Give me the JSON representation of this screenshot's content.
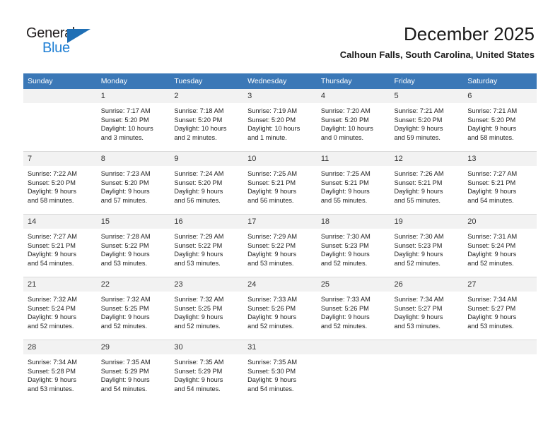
{
  "brand": {
    "name_top": "General",
    "name_bottom": "Blue",
    "triangle_color": "#1f6fb5",
    "blue_color": "#1f7fd4"
  },
  "header": {
    "title": "December 2025",
    "subtitle": "Calhoun Falls, South Carolina, United States"
  },
  "theme": {
    "header_row_bg": "#3b78b7",
    "header_row_text": "#ffffff",
    "daynum_bg": "#f2f2f2",
    "cell_border": "#d9d9d9"
  },
  "weekday_headers": [
    "Sunday",
    "Monday",
    "Tuesday",
    "Wednesday",
    "Thursday",
    "Friday",
    "Saturday"
  ],
  "weeks": [
    [
      {
        "day": "",
        "sunrise": "",
        "sunset": "",
        "daylight_line1": "",
        "daylight_line2": ""
      },
      {
        "day": "1",
        "sunrise": "Sunrise: 7:17 AM",
        "sunset": "Sunset: 5:20 PM",
        "daylight_line1": "Daylight: 10 hours",
        "daylight_line2": "and 3 minutes."
      },
      {
        "day": "2",
        "sunrise": "Sunrise: 7:18 AM",
        "sunset": "Sunset: 5:20 PM",
        "daylight_line1": "Daylight: 10 hours",
        "daylight_line2": "and 2 minutes."
      },
      {
        "day": "3",
        "sunrise": "Sunrise: 7:19 AM",
        "sunset": "Sunset: 5:20 PM",
        "daylight_line1": "Daylight: 10 hours",
        "daylight_line2": "and 1 minute."
      },
      {
        "day": "4",
        "sunrise": "Sunrise: 7:20 AM",
        "sunset": "Sunset: 5:20 PM",
        "daylight_line1": "Daylight: 10 hours",
        "daylight_line2": "and 0 minutes."
      },
      {
        "day": "5",
        "sunrise": "Sunrise: 7:21 AM",
        "sunset": "Sunset: 5:20 PM",
        "daylight_line1": "Daylight: 9 hours",
        "daylight_line2": "and 59 minutes."
      },
      {
        "day": "6",
        "sunrise": "Sunrise: 7:21 AM",
        "sunset": "Sunset: 5:20 PM",
        "daylight_line1": "Daylight: 9 hours",
        "daylight_line2": "and 58 minutes."
      }
    ],
    [
      {
        "day": "7",
        "sunrise": "Sunrise: 7:22 AM",
        "sunset": "Sunset: 5:20 PM",
        "daylight_line1": "Daylight: 9 hours",
        "daylight_line2": "and 58 minutes."
      },
      {
        "day": "8",
        "sunrise": "Sunrise: 7:23 AM",
        "sunset": "Sunset: 5:20 PM",
        "daylight_line1": "Daylight: 9 hours",
        "daylight_line2": "and 57 minutes."
      },
      {
        "day": "9",
        "sunrise": "Sunrise: 7:24 AM",
        "sunset": "Sunset: 5:20 PM",
        "daylight_line1": "Daylight: 9 hours",
        "daylight_line2": "and 56 minutes."
      },
      {
        "day": "10",
        "sunrise": "Sunrise: 7:25 AM",
        "sunset": "Sunset: 5:21 PM",
        "daylight_line1": "Daylight: 9 hours",
        "daylight_line2": "and 56 minutes."
      },
      {
        "day": "11",
        "sunrise": "Sunrise: 7:25 AM",
        "sunset": "Sunset: 5:21 PM",
        "daylight_line1": "Daylight: 9 hours",
        "daylight_line2": "and 55 minutes."
      },
      {
        "day": "12",
        "sunrise": "Sunrise: 7:26 AM",
        "sunset": "Sunset: 5:21 PM",
        "daylight_line1": "Daylight: 9 hours",
        "daylight_line2": "and 55 minutes."
      },
      {
        "day": "13",
        "sunrise": "Sunrise: 7:27 AM",
        "sunset": "Sunset: 5:21 PM",
        "daylight_line1": "Daylight: 9 hours",
        "daylight_line2": "and 54 minutes."
      }
    ],
    [
      {
        "day": "14",
        "sunrise": "Sunrise: 7:27 AM",
        "sunset": "Sunset: 5:21 PM",
        "daylight_line1": "Daylight: 9 hours",
        "daylight_line2": "and 54 minutes."
      },
      {
        "day": "15",
        "sunrise": "Sunrise: 7:28 AM",
        "sunset": "Sunset: 5:22 PM",
        "daylight_line1": "Daylight: 9 hours",
        "daylight_line2": "and 53 minutes."
      },
      {
        "day": "16",
        "sunrise": "Sunrise: 7:29 AM",
        "sunset": "Sunset: 5:22 PM",
        "daylight_line1": "Daylight: 9 hours",
        "daylight_line2": "and 53 minutes."
      },
      {
        "day": "17",
        "sunrise": "Sunrise: 7:29 AM",
        "sunset": "Sunset: 5:22 PM",
        "daylight_line1": "Daylight: 9 hours",
        "daylight_line2": "and 53 minutes."
      },
      {
        "day": "18",
        "sunrise": "Sunrise: 7:30 AM",
        "sunset": "Sunset: 5:23 PM",
        "daylight_line1": "Daylight: 9 hours",
        "daylight_line2": "and 52 minutes."
      },
      {
        "day": "19",
        "sunrise": "Sunrise: 7:30 AM",
        "sunset": "Sunset: 5:23 PM",
        "daylight_line1": "Daylight: 9 hours",
        "daylight_line2": "and 52 minutes."
      },
      {
        "day": "20",
        "sunrise": "Sunrise: 7:31 AM",
        "sunset": "Sunset: 5:24 PM",
        "daylight_line1": "Daylight: 9 hours",
        "daylight_line2": "and 52 minutes."
      }
    ],
    [
      {
        "day": "21",
        "sunrise": "Sunrise: 7:32 AM",
        "sunset": "Sunset: 5:24 PM",
        "daylight_line1": "Daylight: 9 hours",
        "daylight_line2": "and 52 minutes."
      },
      {
        "day": "22",
        "sunrise": "Sunrise: 7:32 AM",
        "sunset": "Sunset: 5:25 PM",
        "daylight_line1": "Daylight: 9 hours",
        "daylight_line2": "and 52 minutes."
      },
      {
        "day": "23",
        "sunrise": "Sunrise: 7:32 AM",
        "sunset": "Sunset: 5:25 PM",
        "daylight_line1": "Daylight: 9 hours",
        "daylight_line2": "and 52 minutes."
      },
      {
        "day": "24",
        "sunrise": "Sunrise: 7:33 AM",
        "sunset": "Sunset: 5:26 PM",
        "daylight_line1": "Daylight: 9 hours",
        "daylight_line2": "and 52 minutes."
      },
      {
        "day": "25",
        "sunrise": "Sunrise: 7:33 AM",
        "sunset": "Sunset: 5:26 PM",
        "daylight_line1": "Daylight: 9 hours",
        "daylight_line2": "and 52 minutes."
      },
      {
        "day": "26",
        "sunrise": "Sunrise: 7:34 AM",
        "sunset": "Sunset: 5:27 PM",
        "daylight_line1": "Daylight: 9 hours",
        "daylight_line2": "and 53 minutes."
      },
      {
        "day": "27",
        "sunrise": "Sunrise: 7:34 AM",
        "sunset": "Sunset: 5:27 PM",
        "daylight_line1": "Daylight: 9 hours",
        "daylight_line2": "and 53 minutes."
      }
    ],
    [
      {
        "day": "28",
        "sunrise": "Sunrise: 7:34 AM",
        "sunset": "Sunset: 5:28 PM",
        "daylight_line1": "Daylight: 9 hours",
        "daylight_line2": "and 53 minutes."
      },
      {
        "day": "29",
        "sunrise": "Sunrise: 7:35 AM",
        "sunset": "Sunset: 5:29 PM",
        "daylight_line1": "Daylight: 9 hours",
        "daylight_line2": "and 54 minutes."
      },
      {
        "day": "30",
        "sunrise": "Sunrise: 7:35 AM",
        "sunset": "Sunset: 5:29 PM",
        "daylight_line1": "Daylight: 9 hours",
        "daylight_line2": "and 54 minutes."
      },
      {
        "day": "31",
        "sunrise": "Sunrise: 7:35 AM",
        "sunset": "Sunset: 5:30 PM",
        "daylight_line1": "Daylight: 9 hours",
        "daylight_line2": "and 54 minutes."
      },
      {
        "day": "",
        "sunrise": "",
        "sunset": "",
        "daylight_line1": "",
        "daylight_line2": ""
      },
      {
        "day": "",
        "sunrise": "",
        "sunset": "",
        "daylight_line1": "",
        "daylight_line2": ""
      },
      {
        "day": "",
        "sunrise": "",
        "sunset": "",
        "daylight_line1": "",
        "daylight_line2": ""
      }
    ]
  ]
}
